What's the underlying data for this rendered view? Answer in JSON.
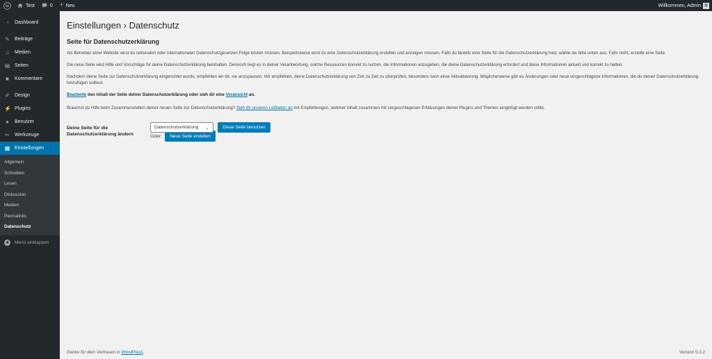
{
  "adminbar": {
    "site_name": "Test",
    "comments_count": "0",
    "new_label": "Neu",
    "greeting": "Willkommen, Admin"
  },
  "sidebar": {
    "items": [
      {
        "label": "Dashboard",
        "icon": "dashboard-icon"
      },
      {
        "label": "Beiträge",
        "icon": "pin-icon"
      },
      {
        "label": "Medien",
        "icon": "media-icon"
      },
      {
        "label": "Seiten",
        "icon": "pages-icon"
      },
      {
        "label": "Kommentare",
        "icon": "comment-icon"
      },
      {
        "label": "Design",
        "icon": "brush-icon"
      },
      {
        "label": "Plugins",
        "icon": "plugin-icon"
      },
      {
        "label": "Benutzer",
        "icon": "user-icon"
      },
      {
        "label": "Werkzeuge",
        "icon": "wrench-icon"
      },
      {
        "label": "Einstellungen",
        "icon": "settings-icon"
      }
    ],
    "submenu": [
      "Allgemein",
      "Schreiben",
      "Lesen",
      "Diskussion",
      "Medien",
      "Permalinks",
      "Datenschutz"
    ],
    "collapse_label": "Menü einklappen"
  },
  "page": {
    "title": "Einstellungen › Datenschutz",
    "section_title": "Seite für Datenschutzerklärung",
    "para1": "Als Betreiber einer Website wirst du nationalen oder internationalen Datenschutzgesetzen Folge leisten müssen. Beispielsweise wirst du eine Datenschutzerklärung erstellen und anzeigen müssen. Falls du bereits eine Seite für die Datenschutzerklärung hast, wähle sie bitte unten aus. Falls nicht, erstelle eine Seite.",
    "para2": "Die neue Seite wird Hilfe und Vorschläge für deine Datenschutzerklärung beinhalten. Dennoch liegt es in deiner Verantwortung, solche Ressourcen korrekt zu nutzen, die Informationen anzugeben, die deine Datenschutzerklärung erfordert und diese Informationen aktuell und korrekt zu halten.",
    "para3": "Nachdem deine Seite zur Datenschutzerklärung eingerichtet wurde, empfehlen wir dir, sie anzupassen. Wir empfehlen, deine Datenschutzerklärung von Zeit zu Zeit zu überprüfen, besonders nach einer Aktualisierung. Möglicherweise gibt es Änderungen oder neue vorgeschlagene Informationen, die du deiner Datenschutzerklärung hinzufügen solltest.",
    "edit_link": "Bearbeite",
    "edit_mid": " den Inhalt der Seite deiner Datenschutzerklärung oder sieh dir eine ",
    "preview_link": "Voransicht",
    "edit_end": " an.",
    "help_start": "Brauchst du Hilfe beim Zusammenstellen deiner neuen Seite zur Datenschutzerklärung? ",
    "help_link": "Sieh dir unseren Leitfaden an",
    "help_end": " mit Empfehlungen, welcher Inhalt zusammen mit vorgeschlagenen Erklärungen deiner Plugins und Themes eingefügt werden sollte.",
    "form_label": "Deine Seite für die Datenschutzerklärung ändern",
    "select_value": "Datenschutzerklärung",
    "use_button": "Diese Seite benutzen",
    "or_label": "Oder:",
    "create_button": "Neue Seite erstellen"
  },
  "footer": {
    "thanks_prefix": "Danke für dein Vertrauen in ",
    "thanks_link": "WordPress",
    "thanks_suffix": ".",
    "version": "Version 5.3.2"
  },
  "colors": {
    "accent": "#0073aa",
    "button": "#007cba",
    "sidebar_bg": "#23282d",
    "page_bg": "#f1f1f1"
  }
}
